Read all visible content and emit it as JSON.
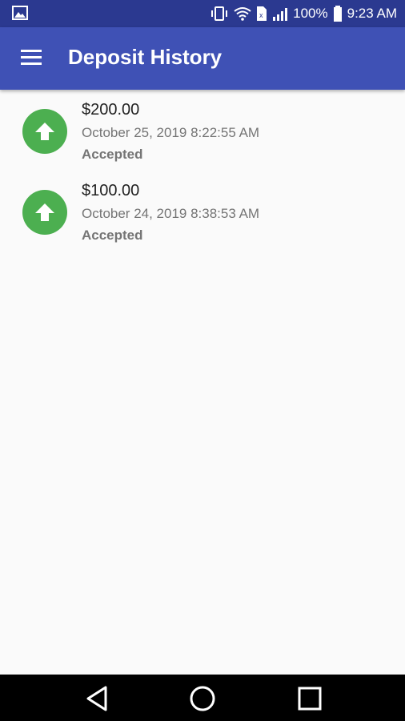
{
  "status_bar": {
    "battery_pct": "100%",
    "time": "9:23 AM",
    "icons": [
      "image-icon",
      "vibrate-icon",
      "wifi-icon",
      "sim-icon",
      "signal-icon",
      "battery-icon"
    ]
  },
  "app_bar": {
    "title": "Deposit History",
    "menu_icon": "hamburger-menu-icon",
    "color": "#3f51b5"
  },
  "deposits": [
    {
      "amount": "$200.00",
      "date": "October 25, 2019 8:22:55 AM",
      "status": "Accepted",
      "icon": "arrow-up-icon"
    },
    {
      "amount": "$100.00",
      "date": "October 24, 2019 8:38:53 AM",
      "status": "Accepted",
      "icon": "arrow-up-icon"
    }
  ],
  "nav_bar": {
    "buttons": [
      "back-icon",
      "home-icon",
      "recents-icon"
    ]
  },
  "colors": {
    "status_bar": "#2b3990",
    "accent_green": "#4caf50",
    "background": "#fafafa"
  }
}
